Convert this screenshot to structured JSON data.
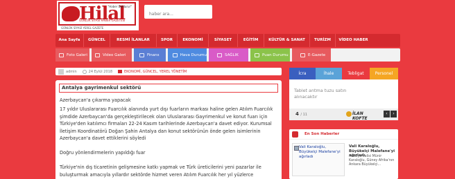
{
  "header": {
    "logo_text": "Hilal",
    "logo_slogan": "\"Haber Doldurur\"",
    "logo_tagline": "GÜNLÜK SİYASİ HABER GAZETESİ",
    "logo_subtitle": "GÜNLÜK SİYASİ YEREL GAZETE"
  },
  "search": {
    "placeholder": "haber ara..."
  },
  "nav": {
    "items": [
      "Ana Sayfa",
      "GÜNCEL",
      "RESMİ İLANLAR",
      "SPOR",
      "EKONOMİ",
      "SİYASET",
      "EĞİTİM",
      "KÜLTÜR & SANAT",
      "TURİZM",
      "VİDEO HABER"
    ]
  },
  "subnav": {
    "items": [
      {
        "label": "Foto Galeri",
        "color": "#e75a5e",
        "icon": "camera-icon"
      },
      {
        "label": "Video Galeri",
        "color": "#e75a5e",
        "icon": "video-icon"
      },
      {
        "label": "Finans",
        "color": "#5b7fd4",
        "icon": "chart-icon"
      },
      {
        "label": "Hava Durumu",
        "color": "#4f8be0",
        "icon": "cloud-icon"
      },
      {
        "label": "SAĞLIK",
        "color": "#d95bc7",
        "icon": "heart-icon"
      },
      {
        "label": "Puan Durumu",
        "color": "#8bc34a",
        "icon": "ball-icon"
      },
      {
        "label": "E-Gazete",
        "color": "#e75a5e",
        "icon": "newspaper-icon"
      }
    ]
  },
  "article_meta": {
    "author": "admin",
    "date": "24 Eylül 2018",
    "categories": "EKONOMİ, GÜNCEL, YEREL YÖNETİM"
  },
  "article": {
    "title": "Antalya gayrimenkul sektörü",
    "paragraphs": [
      "Azerbaycan'a çıkarma yapacak",
      "17 yıldır Uluslararası Fuarcılık alanında yurt dışı fuarların markası haline gelen Atılım Fuarcılık şimdide Azerbaycan'da gerçekleştirilecek olan Uluslararası Gayrimenkul ve konut fuarı için Türkiye'den katılımcı firmaları 22-24 Kasım tarihlerinde Azerbaycan'a davet ediyor. Kurumsal İletişim Koordinatörü Doğan Şahin Antalya dan konut sektörünün önde gelen isimlerinin Azerbaycan'a davet ettiklerini söyledi",
      "Doğru yönlendirmelerin yapıldığı fuar",
      "Türkiye'nin dış ticaretinin gelişmesine katkı yapmak ve Türk üreticilerini yeni pazarlar ile buluşturmak amacıyla yıllardır sektörde hizmet veren Atılım Fuarcılık her yıl yüzlerce"
    ]
  },
  "tabs": [
    {
      "label": "İcra",
      "color": "#3a5fbf"
    },
    {
      "label": "İhale",
      "color": "#5aa3d8"
    },
    {
      "label": "Tebligat",
      "color": "#ea3a3f"
    },
    {
      "label": "Personel",
      "color": "#f5a623"
    }
  ],
  "tender": {
    "title": "Tablet antma tuzu satın alınacaktır",
    "current": "4",
    "total": "/ 11",
    "logo": "İLAN KOFTE"
  },
  "latest_news": {
    "heading": "En Son Haberler",
    "thumb_alt": "Vali Karaloğlu, Büyükelçi Malefane'yi ağırladı",
    "title": "Vali Karaloğlu, Büyükelçi Malefane'yi ağırladı",
    "description": "Antalya Valisi Münir Karaloğlu, Güney Afrika'nın Ankara Büyükelçi..."
  }
}
